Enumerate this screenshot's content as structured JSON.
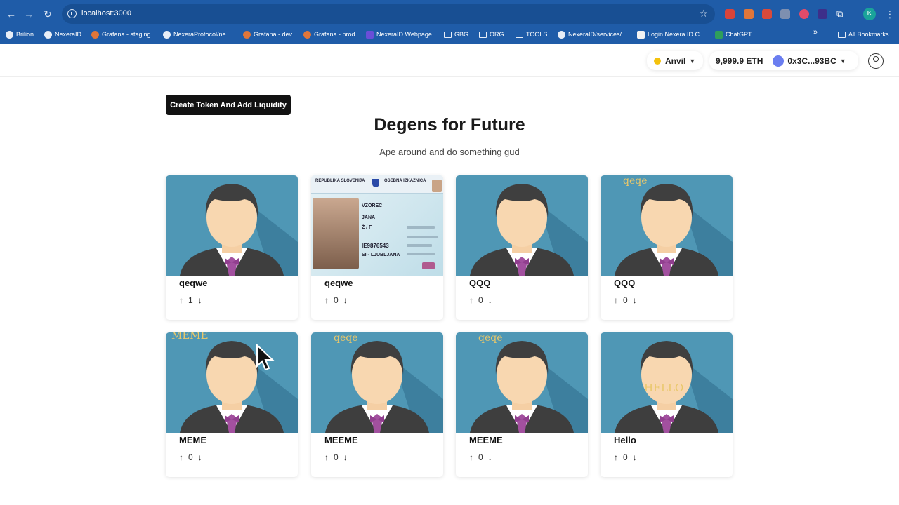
{
  "browser": {
    "url": "localhost:3000",
    "bookmarks": [
      {
        "label": "Brilion",
        "icon": "github-icon"
      },
      {
        "label": "NexeraID",
        "icon": "github-icon"
      },
      {
        "label": "Grafana - staging",
        "icon": "grafana-icon"
      },
      {
        "label": "NexeraProtocol/ne...",
        "icon": "github-icon"
      },
      {
        "label": "Grafana - dev",
        "icon": "grafana-icon"
      },
      {
        "label": "Grafana - prod",
        "icon": "grafana-icon"
      },
      {
        "label": "NexeraID Webpage",
        "icon": "site-icon"
      },
      {
        "label": "GBG",
        "icon": "folder-icon"
      },
      {
        "label": "ORG",
        "icon": "folder-icon"
      },
      {
        "label": "TOOLS",
        "icon": "folder-icon"
      },
      {
        "label": "NexeraID/services/...",
        "icon": "github-icon"
      },
      {
        "label": "Login Nexera ID C...",
        "icon": "site-icon"
      },
      {
        "label": "ChatGPT",
        "icon": "chatgpt-icon"
      }
    ],
    "all_bookmarks": "All Bookmarks",
    "profile_initial": "K",
    "more_bookmarks": "»"
  },
  "header": {
    "network": "Anvil",
    "balance": "9,999.9 ETH",
    "account": "0x3C...93BC"
  },
  "main": {
    "create_button": "Create Token And Add Liquidity",
    "title": "Degens for Future",
    "subtitle": "Ape around and do something gud"
  },
  "cards": [
    {
      "name": "qeqwe",
      "votes": "1",
      "image": "avatar",
      "overlay": ""
    },
    {
      "name": "qeqwe",
      "votes": "0",
      "image": "id-card",
      "overlay": ""
    },
    {
      "name": "QQQ",
      "votes": "0",
      "image": "avatar",
      "overlay": ""
    },
    {
      "name": "QQQ",
      "votes": "0",
      "image": "avatar",
      "overlay": "qeqe"
    },
    {
      "name": "MEME",
      "votes": "0",
      "image": "avatar",
      "overlay": "MEME"
    },
    {
      "name": "MEEME",
      "votes": "0",
      "image": "avatar",
      "overlay": "qeqe"
    },
    {
      "name": "MEEME",
      "votes": "0",
      "image": "avatar",
      "overlay": "qeqe"
    },
    {
      "name": "Hello",
      "votes": "0",
      "image": "avatar",
      "overlay": "HELLO"
    }
  ],
  "id_card": {
    "country": "REPUBLIKA SLOVENIJA",
    "doc": "OSEBNA IZKAZNICA",
    "surname": "VZOREC",
    "given": "JANA",
    "sex": "Ž / F",
    "number": "IE9876543",
    "place": "SI - LJUBLJANA"
  },
  "colors": {
    "chrome": "#1f5ca8",
    "avatar_bg": "#4f97b5",
    "button_bg": "#121212"
  }
}
